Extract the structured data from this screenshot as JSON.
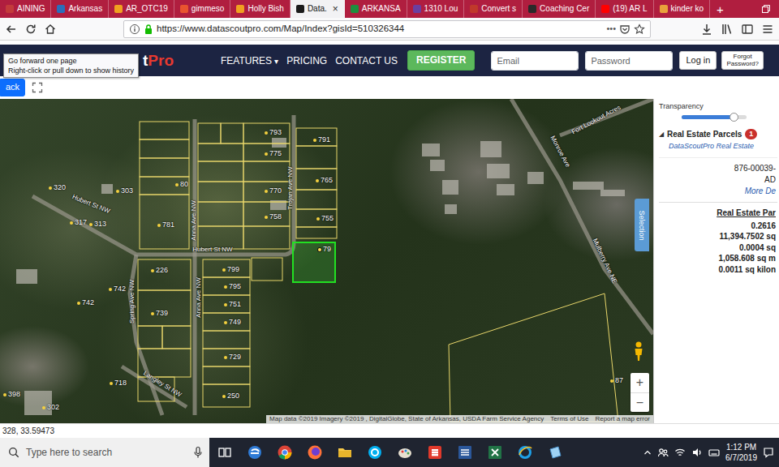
{
  "browser": {
    "tabs": [
      {
        "label": "AINING",
        "selected": false
      },
      {
        "label": "Arkansas",
        "selected": false
      },
      {
        "label": "AR_OTC19",
        "selected": false
      },
      {
        "label": "gimmeso",
        "selected": false
      },
      {
        "label": "Holly Bish",
        "selected": false
      },
      {
        "label": "Data.",
        "selected": true
      },
      {
        "label": "ARKANSA",
        "selected": false
      },
      {
        "label": "1310 Lou",
        "selected": false
      },
      {
        "label": "Convert s",
        "selected": false
      },
      {
        "label": "Coaching Cer",
        "selected": false
      },
      {
        "label": "(19) AR L",
        "selected": false
      },
      {
        "label": "kinder ko",
        "selected": false
      }
    ],
    "tab_close": "×",
    "new_tab": "+",
    "url": "https://www.datascoutpro.com/Map/Index?gisId=510326344",
    "page_actions": "•••",
    "tooltip": [
      "Go forward one page",
      "Right-click or pull down to show history"
    ]
  },
  "site": {
    "logo": [
      {
        "text": "t",
        "color": "#ffffff"
      },
      {
        "text": "Pro",
        "color": "#e8392f"
      }
    ],
    "nav": [
      "FEATURES",
      "PRICING",
      "CONTACT US"
    ],
    "features_caret": "▾",
    "register": "REGISTER",
    "email_placeholder": "Email",
    "password_placeholder": "Password",
    "login": "Log in",
    "forgot": [
      "Forgot",
      "Password?"
    ]
  },
  "toolbar": {
    "back": "ack"
  },
  "map": {
    "parcel_labels": [
      {
        "text": "320",
        "selected": false
      },
      {
        "text": "303",
        "selected": false
      },
      {
        "text": "317",
        "selected": false
      },
      {
        "text": "313",
        "selected": false
      },
      {
        "text": "742",
        "selected": false
      },
      {
        "text": "742",
        "selected": false
      },
      {
        "text": "226",
        "selected": false
      },
      {
        "text": "739",
        "selected": false
      },
      {
        "text": "718",
        "selected": false
      },
      {
        "text": "398",
        "selected": false
      },
      {
        "text": "302",
        "selected": false
      },
      {
        "text": "781",
        "selected": false
      },
      {
        "text": "80",
        "selected": false
      },
      {
        "text": "799",
        "selected": false
      },
      {
        "text": "795",
        "selected": false
      },
      {
        "text": "751",
        "selected": false
      },
      {
        "text": "749",
        "selected": false
      },
      {
        "text": "729",
        "selected": false
      },
      {
        "text": "250",
        "selected": false
      },
      {
        "text": "791",
        "selected": false
      },
      {
        "text": "765",
        "selected": false
      },
      {
        "text": "755",
        "selected": false
      },
      {
        "text": "758",
        "selected": false
      },
      {
        "text": "770",
        "selected": false
      },
      {
        "text": "775",
        "selected": false
      },
      {
        "text": "793",
        "selected": false
      },
      {
        "text": "79",
        "selected": true
      },
      {
        "text": "87",
        "selected": false
      }
    ],
    "streets": [
      "Hubert St NW",
      "Hubert St NW",
      "Spring Ave NW",
      "Anna Ave NW",
      "Anna Ave NW",
      "Trojan Ave NW",
      "Monroe Ave",
      "Fort Lookout Acres",
      "Mulberry Ave NE",
      "Langley St NW"
    ],
    "attribution": [
      "Map data ©2019 Imagery ©2019 , DigitalGlobe, State of Arkansas, USDA Farm Service Agency",
      "Terms of Use",
      "Report a map error"
    ],
    "zoom_in": "+",
    "zoom_out": "−",
    "selection_tab": "Selection"
  },
  "panel": {
    "transparency": {
      "label": "Transparency",
      "level": 0.8
    },
    "layer": {
      "expander": "◢",
      "title": "Real Estate Parcels",
      "count": "1",
      "source": "DataScoutPro Real Estate"
    },
    "record": {
      "id": "876-00039-",
      "name": "AD",
      "more": "More De"
    },
    "details": {
      "title": "Real Estate Par",
      "values": [
        "0.2616",
        "11,394.7502 sq",
        "0.0004 sq",
        "1,058.608 sq m",
        "0.0011 sq kilon"
      ]
    }
  },
  "status_bar": "328, 33.59473",
  "taskbar": {
    "search": "Type here to search",
    "time": "1:12 PM",
    "date": "6/7/2019"
  }
}
